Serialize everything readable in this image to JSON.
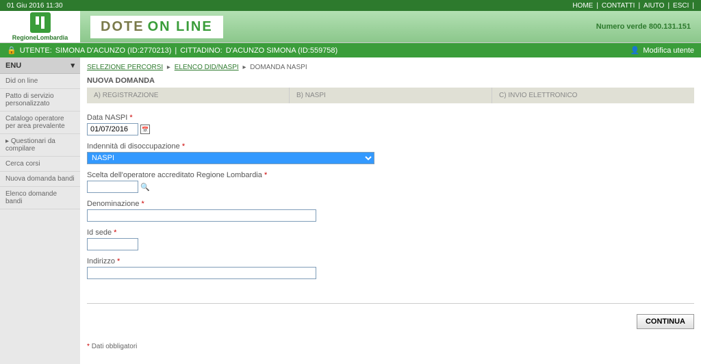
{
  "topbar": {
    "datetime": "01 Giu 2016 11:30",
    "links": [
      "HOME",
      "CONTATTI",
      "AIUTO",
      "ESCI"
    ]
  },
  "logo": {
    "text": "RegioneLombardia"
  },
  "title": {
    "dote": "DOTE",
    "online": "ON LINE"
  },
  "numero_verde": "Numero verde 800.131.151",
  "userbar": {
    "utente_label": "UTENTE:",
    "utente": "SIMONA D'ACUNZO (ID:2770213)",
    "sep": "|",
    "cittadino_label": "CITTADINO:",
    "cittadino": "D'ACUNZO SIMONA (ID:559758)",
    "modifica": "Modifica utente"
  },
  "sidebar": {
    "header": "ENU",
    "items": [
      "Did on line",
      "Patto di servizio personalizzato",
      "Catalogo operatore per area prevalente",
      "Questionari da compilare",
      "Cerca corsi",
      "Nuova domanda bandi",
      "Elenco domande bandi"
    ]
  },
  "breadcrumb": {
    "link1": "SELEZIONE PERCORSI",
    "link2": "ELENCO DID/NASPI",
    "current": "DOMANDA NASPI"
  },
  "page_title": "NUOVA DOMANDA",
  "steps": {
    "a": "A) REGISTRAZIONE",
    "b": "B) NASPI",
    "c": "C) INVIO ELETTRONICO"
  },
  "form": {
    "data_naspi_label": "Data NASPI",
    "data_naspi_value": "01/07/2016",
    "indennita_label": "Indennità di disoccupazione",
    "indennita_value": "NASPI",
    "operatore_label": "Scelta dell'operatore accreditato Regione Lombardia",
    "operatore_value": "",
    "denominazione_label": "Denominazione",
    "denominazione_value": "",
    "idsede_label": "Id sede",
    "idsede_value": "",
    "indirizzo_label": "Indirizzo",
    "indirizzo_value": ""
  },
  "button_continua": "CONTINUA",
  "footnote": {
    "star": "*",
    "text": "Dati obbligatori"
  }
}
